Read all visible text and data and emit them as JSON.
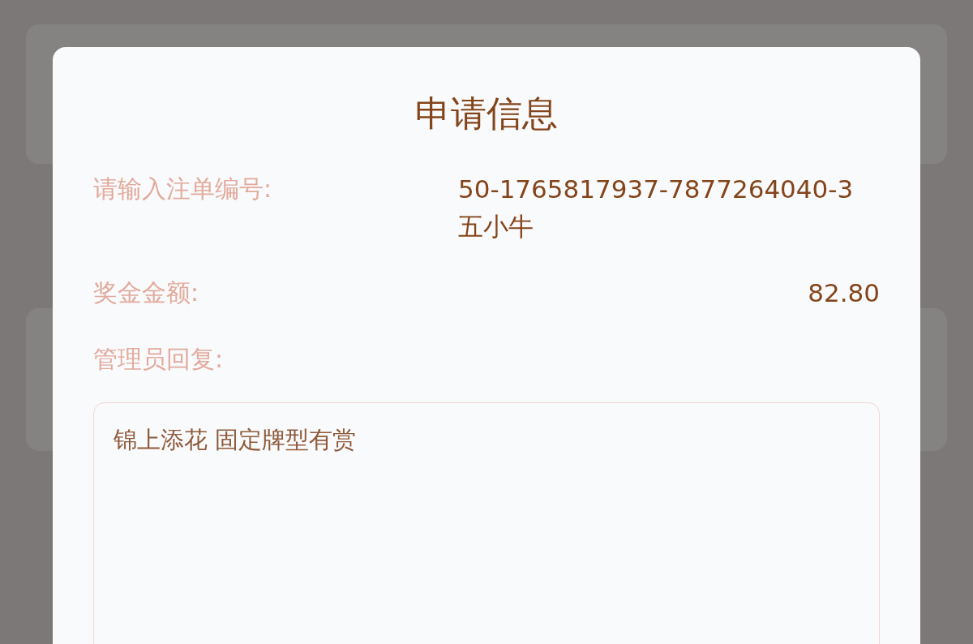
{
  "dialog": {
    "title": "申请信息",
    "fields": [
      {
        "label": "请输入注单编号:",
        "value": "50-1765817937-7877264040-3",
        "extra": "五小牛",
        "kind": "stacked"
      },
      {
        "label": "奖金金额:",
        "value": "82.80",
        "kind": "single"
      }
    ],
    "reply_label": "管理员回复:",
    "reply_text": "锦上添花 固定牌型有赏"
  }
}
